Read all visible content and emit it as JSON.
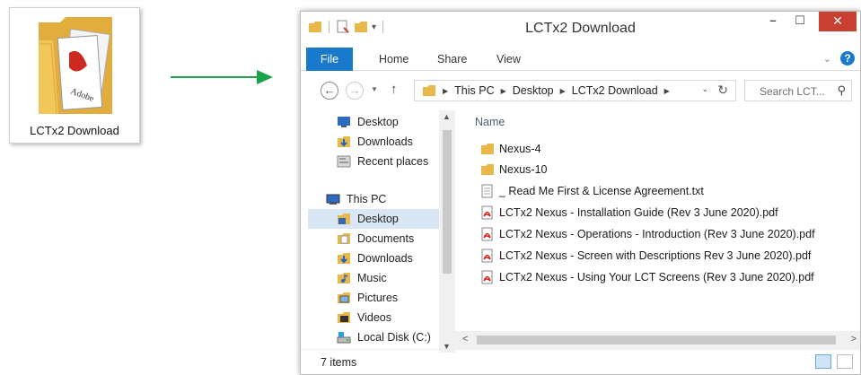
{
  "desktop_icon": {
    "label": "LCTx2 Download"
  },
  "window": {
    "title": "LCTx2 Download",
    "controls": {
      "minimize": "–",
      "maximize": "☐",
      "close": "✕"
    }
  },
  "ribbon": {
    "file": "File",
    "home": "Home",
    "share": "Share",
    "view": "View"
  },
  "address": {
    "crumbs": [
      "This PC",
      "Desktop",
      "LCTx2 Download"
    ]
  },
  "search": {
    "placeholder": "Search LCT..."
  },
  "nav_pane": {
    "items": [
      "Desktop",
      "Downloads",
      "Recent places",
      "This PC",
      "Desktop",
      "Documents",
      "Downloads",
      "Music",
      "Pictures",
      "Videos",
      "Local Disk (C:)"
    ],
    "selected_index": 4
  },
  "file_list": {
    "column_header": "Name",
    "files": [
      {
        "name": "Nexus-4",
        "type": "folder"
      },
      {
        "name": "Nexus-10",
        "type": "folder"
      },
      {
        "name": "_ Read Me First & License Agreement.txt",
        "type": "txt"
      },
      {
        "name": "LCTx2 Nexus - Installation Guide (Rev 3 June 2020).pdf",
        "type": "pdf"
      },
      {
        "name": "LCTx2 Nexus - Operations - Introduction (Rev 3 June 2020).pdf",
        "type": "pdf"
      },
      {
        "name": "LCTx2 Nexus - Screen with Descriptions Rev 3 June 2020).pdf",
        "type": "pdf"
      },
      {
        "name": "LCTx2 Nexus - Using Your LCT Screens (Rev 3 June 2020).pdf",
        "type": "pdf"
      }
    ]
  },
  "status": {
    "item_count": "7 items"
  },
  "colors": {
    "accent": "#1979ca",
    "arrow": "#1aa34a",
    "close": "#c84031",
    "folder": "#e8b84a",
    "pdf": "#d42b1e"
  }
}
